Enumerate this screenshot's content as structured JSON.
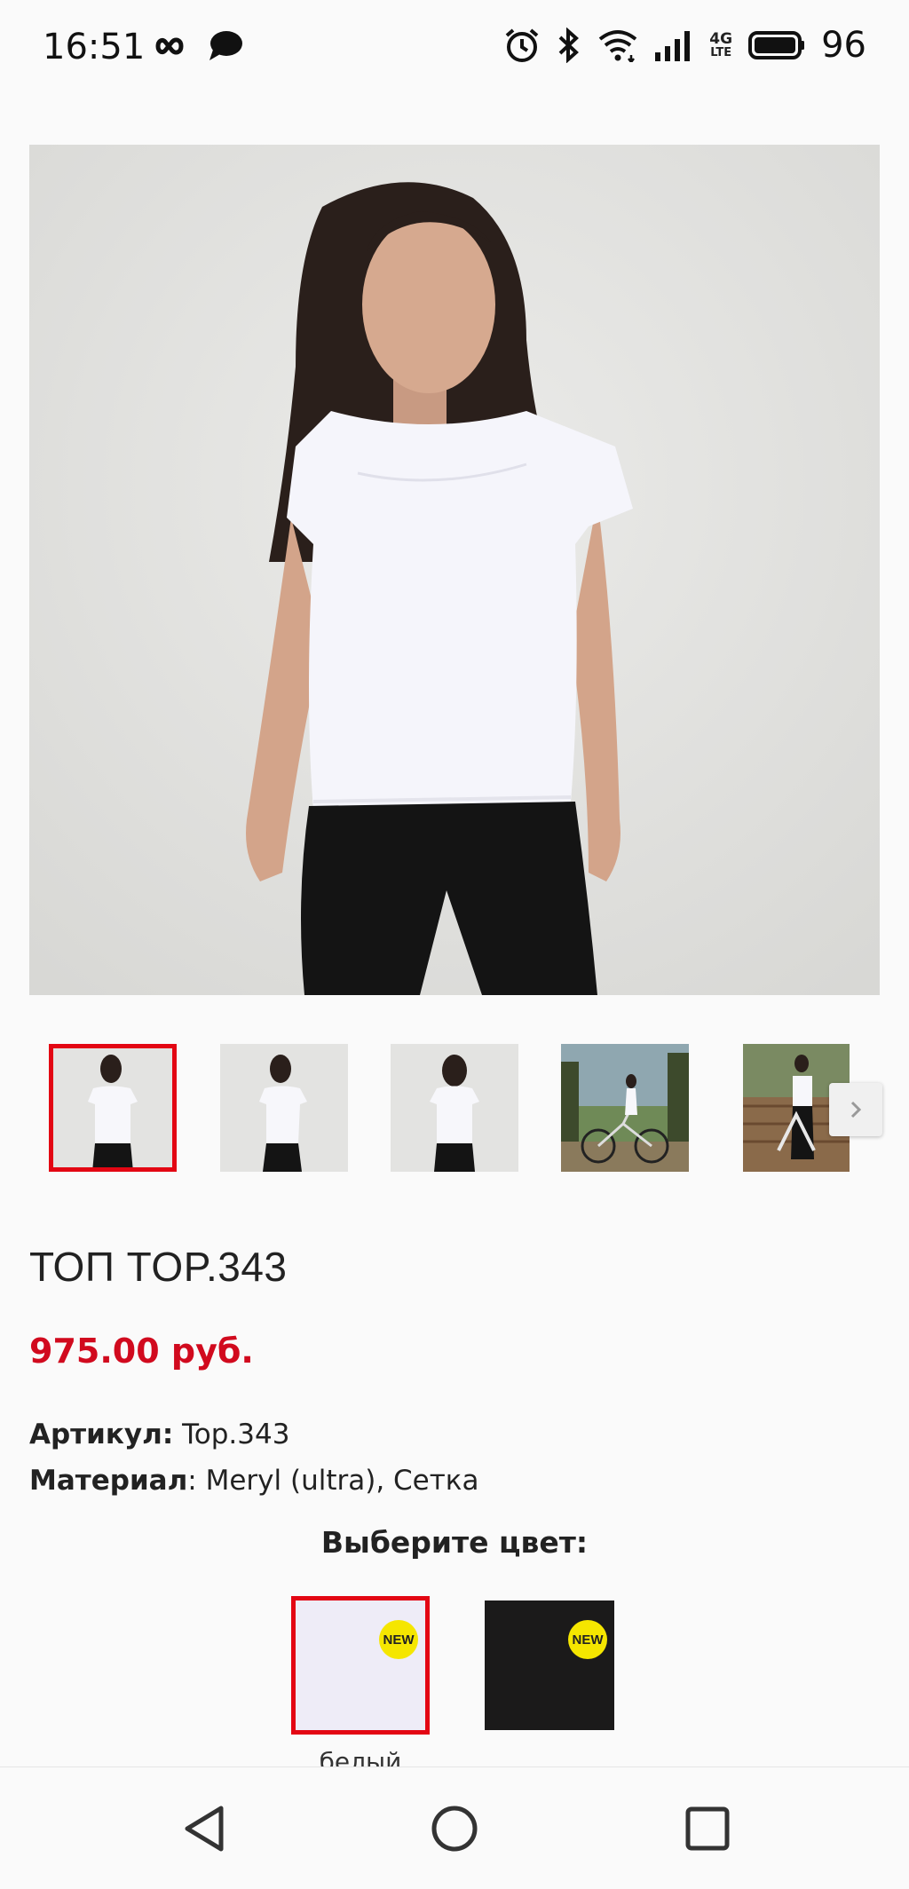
{
  "status_bar": {
    "time": "16:51",
    "left_icons": [
      "infinity-icon",
      "chat-bubble-icon"
    ],
    "right_icons": [
      "alarm-icon",
      "bluetooth-icon",
      "wifi-icon",
      "signal-icon",
      "4g-lte-icon",
      "battery-icon"
    ],
    "network_label_top": "4G",
    "network_label_bottom": "LTE",
    "battery_percent": "96"
  },
  "product": {
    "main_image": "white-t-shirt-model-photo",
    "thumbnails": [
      {
        "name": "front-view",
        "selected": true
      },
      {
        "name": "side-view",
        "selected": false
      },
      {
        "name": "back-view",
        "selected": false
      },
      {
        "name": "outdoor-bike-view",
        "selected": false
      },
      {
        "name": "outdoor-bike-view-2",
        "selected": false
      }
    ],
    "title": "ТОП TOP.343",
    "price": "975.00 руб.",
    "article_label": "Артикул:",
    "article_value": " Top.343",
    "material_label": "Материал",
    "material_value": ": Meryl (ultra), Сетка",
    "color_heading": "Выберите цвет:",
    "colors": [
      {
        "name": "белый",
        "hex": "#eeecf7",
        "badge": "NEW",
        "selected": true
      },
      {
        "name": "",
        "hex": "#1b1a1a",
        "badge": "NEW",
        "selected": false
      }
    ]
  },
  "colors": {
    "accent_red": "#e30613",
    "price_red": "#d10a1e",
    "badge_yellow": "#f5e600"
  },
  "nav_bar": {
    "buttons": [
      "back-triangle-icon",
      "home-circle-icon",
      "recents-square-icon"
    ]
  }
}
